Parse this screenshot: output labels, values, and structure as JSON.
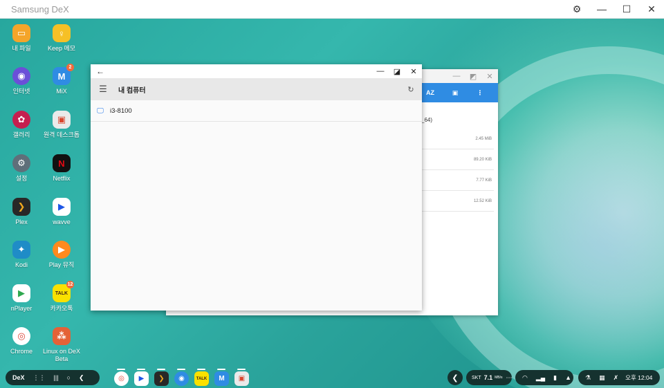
{
  "host": {
    "title": "Samsung DeX",
    "settings_icon": "gear-icon",
    "minimize_icon": "minimize-icon",
    "maximize_icon": "maximize-icon",
    "close_icon": "close-icon"
  },
  "desktop_icons": [
    {
      "label": "내 파일",
      "icon": "folder-icon",
      "color": "#f4a52a"
    },
    {
      "label": "Keep 메모",
      "icon": "lightbulb-icon",
      "color": "#f6c026"
    },
    {
      "label": "인터넷",
      "icon": "internet-icon",
      "color": "#6b4fd8"
    },
    {
      "label": "MiX",
      "icon": "mix-icon",
      "color": "#2f8ce3",
      "badge": "2"
    },
    {
      "label": "갤러리",
      "icon": "flower-icon",
      "color": "#c51f4f"
    },
    {
      "label": "원격 데스크톱",
      "icon": "remote-desktop-icon",
      "color": "#eaeaea"
    },
    {
      "label": "설정",
      "icon": "gear-icon",
      "color": "#5f6f7a"
    },
    {
      "label": "Netflix",
      "icon": "netflix-icon",
      "color": "#111111"
    },
    {
      "label": "Plex",
      "icon": "plex-icon",
      "color": "#282828"
    },
    {
      "label": "wavve",
      "icon": "play-icon",
      "color": "#ffffff"
    },
    {
      "label": "Kodi",
      "icon": "kodi-icon",
      "color": "#1f8cc7"
    },
    {
      "label": "Play 뮤직",
      "icon": "play-music-icon",
      "color": "#ff8a1e"
    },
    {
      "label": "nPlayer",
      "icon": "play-triangle-icon",
      "color": "#ffffff"
    },
    {
      "label": "카카오톡",
      "icon": "talk-icon",
      "color": "#fae100",
      "badge": "12"
    },
    {
      "label": "Chrome",
      "icon": "chrome-icon",
      "color": "#ffffff"
    },
    {
      "label": "Linux on DeX Beta",
      "icon": "linux-icon",
      "color": "#e46237"
    }
  ],
  "back_window": {
    "toolbar": [
      "AZ",
      "▣",
      "⋮"
    ],
    "header_fragment": "_64)",
    "rows": [
      "2.45 MiB",
      "89.20 KiB",
      "7.77 KiB",
      "12.52 KiB"
    ]
  },
  "front_window": {
    "back_icon": "back-arrow-icon",
    "heading": "내 컴퓨터",
    "items": [
      {
        "label": "i3-8100",
        "icon": "computer-icon"
      }
    ]
  },
  "taskbar": {
    "dex_label": "DeX",
    "carrier": "SKT",
    "speed": "7.1",
    "speed_unit": "MB/s",
    "time": "오후 12:04"
  }
}
